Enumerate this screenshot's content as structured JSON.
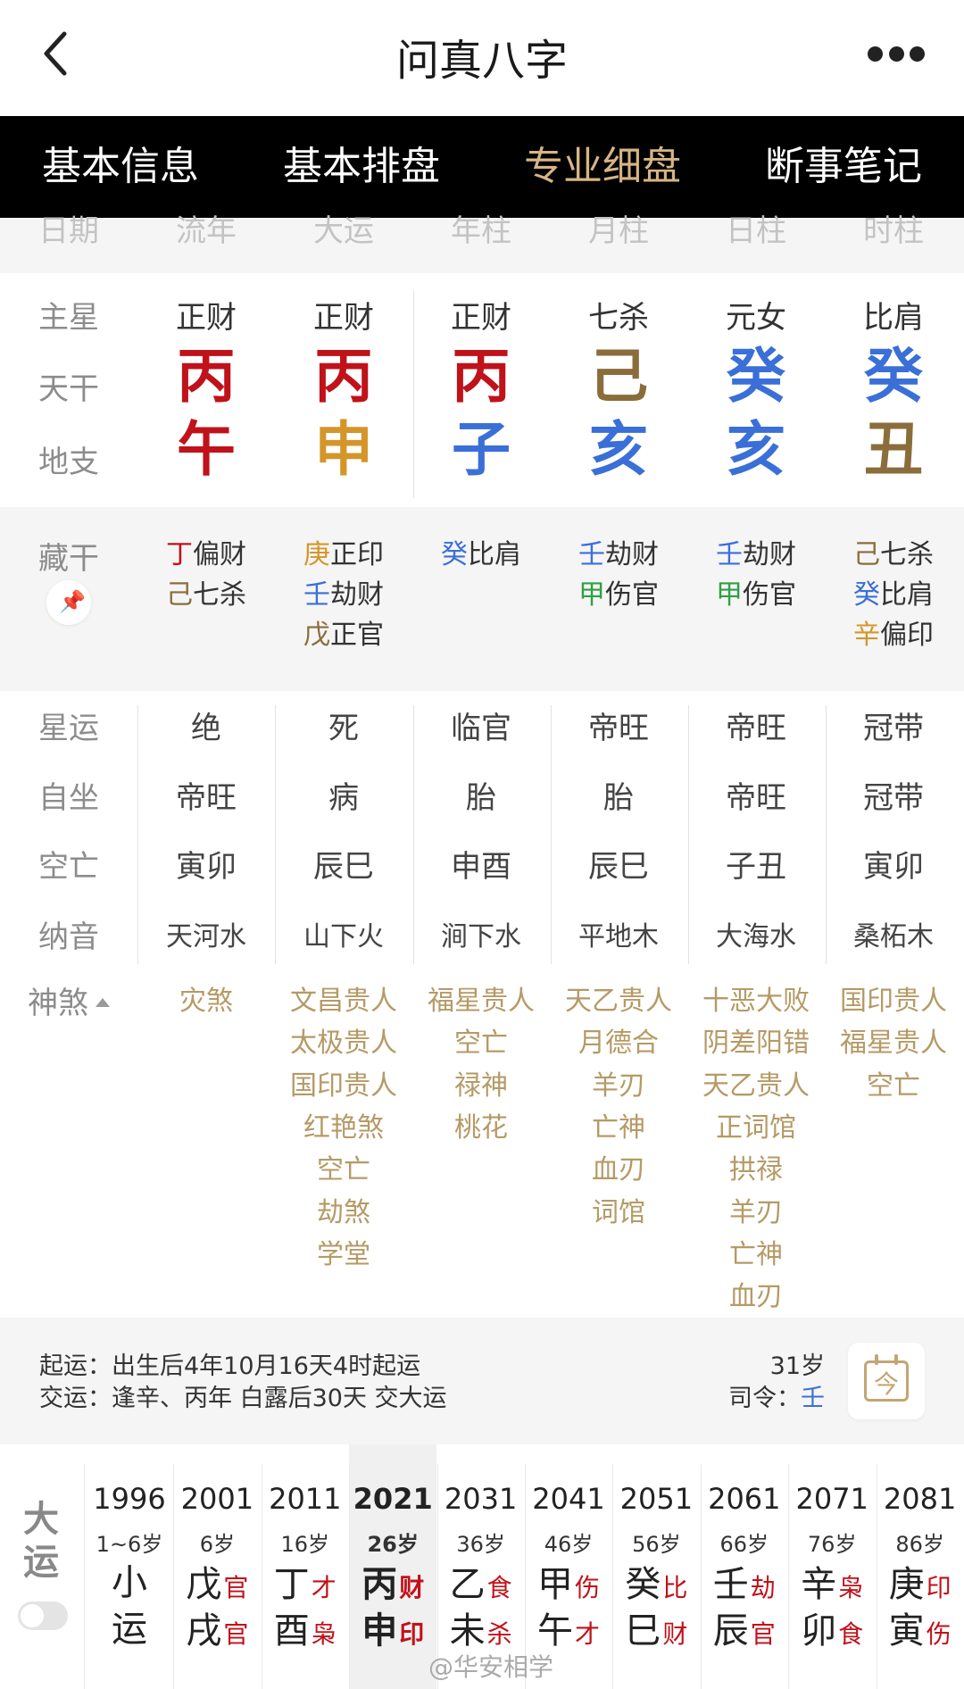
{
  "app": {
    "title": "问真八字"
  },
  "tabs": [
    "基本信息",
    "基本排盘",
    "专业细盘",
    "断事笔记"
  ],
  "column_header": [
    "日期",
    "流年",
    "大运",
    "年柱",
    "月柱",
    "日柱",
    "时柱"
  ],
  "row_labels": {
    "zhuxing": "主星",
    "tiangan": "天干",
    "dizhi": "地支",
    "canggan": "藏干",
    "xingyun": "星运",
    "zizuo": "自坐",
    "kongwang": "空亡",
    "nayin": "纳音",
    "shensha": "神煞"
  },
  "columns": [
    {
      "zhuxing": "正财",
      "tiangan": "丙",
      "tiangan_color": "#c0121a",
      "dizhi": "午",
      "dizhi_color": "#c0121a",
      "canggan": [
        {
          "gan": "丁",
          "color": "#c0121a",
          "shen": "偏财"
        },
        {
          "gan": "己",
          "color": "#8a6d3b",
          "shen": "七杀"
        }
      ],
      "xingyun": "绝",
      "zizuo": "帝旺",
      "kongwang": "寅卯",
      "nayin": "天河水",
      "shensha": [
        "灾煞"
      ]
    },
    {
      "zhuxing": "正财",
      "tiangan": "丙",
      "tiangan_color": "#c0121a",
      "dizhi": "申",
      "dizhi_color": "#d4962a",
      "canggan": [
        {
          "gan": "庚",
          "color": "#d4962a",
          "shen": "正印"
        },
        {
          "gan": "壬",
          "color": "#3a6fd8",
          "shen": "劫财"
        },
        {
          "gan": "戊",
          "color": "#8a6d3b",
          "shen": "正官"
        }
      ],
      "xingyun": "死",
      "zizuo": "病",
      "kongwang": "辰巳",
      "nayin": "山下火",
      "shensha": [
        "文昌贵人",
        "太极贵人",
        "国印贵人",
        "红艳煞",
        "空亡",
        "劫煞",
        "学堂"
      ]
    },
    {
      "zhuxing": "正财",
      "tiangan": "丙",
      "tiangan_color": "#c0121a",
      "dizhi": "子",
      "dizhi_color": "#3a6fd8",
      "canggan": [
        {
          "gan": "癸",
          "color": "#3a6fd8",
          "shen": "比肩"
        }
      ],
      "xingyun": "临官",
      "zizuo": "胎",
      "kongwang": "申酉",
      "nayin": "涧下水",
      "shensha": [
        "福星贵人",
        "空亡",
        "禄神",
        "桃花"
      ]
    },
    {
      "zhuxing": "七杀",
      "tiangan": "己",
      "tiangan_color": "#8a6d3b",
      "dizhi": "亥",
      "dizhi_color": "#3a6fd8",
      "canggan": [
        {
          "gan": "壬",
          "color": "#3a6fd8",
          "shen": "劫财"
        },
        {
          "gan": "甲",
          "color": "#2ea043",
          "shen": "伤官"
        }
      ],
      "xingyun": "帝旺",
      "zizuo": "胎",
      "kongwang": "辰巳",
      "nayin": "平地木",
      "shensha": [
        "天乙贵人",
        "月德合",
        "羊刃",
        "亡神",
        "血刃",
        "词馆"
      ]
    },
    {
      "zhuxing": "元女",
      "tiangan": "癸",
      "tiangan_color": "#3a6fd8",
      "dizhi": "亥",
      "dizhi_color": "#3a6fd8",
      "canggan": [
        {
          "gan": "壬",
          "color": "#3a6fd8",
          "shen": "劫财"
        },
        {
          "gan": "甲",
          "color": "#2ea043",
          "shen": "伤官"
        }
      ],
      "xingyun": "帝旺",
      "zizuo": "帝旺",
      "kongwang": "子丑",
      "nayin": "大海水",
      "shensha": [
        "十恶大败",
        "阴差阳错",
        "天乙贵人",
        "正词馆",
        "拱禄",
        "羊刃",
        "亡神",
        "血刃"
      ]
    },
    {
      "zhuxing": "比肩",
      "tiangan": "癸",
      "tiangan_color": "#3a6fd8",
      "dizhi": "丑",
      "dizhi_color": "#8a6d3b",
      "canggan": [
        {
          "gan": "己",
          "color": "#8a6d3b",
          "shen": "七杀"
        },
        {
          "gan": "癸",
          "color": "#3a6fd8",
          "shen": "比肩"
        },
        {
          "gan": "辛",
          "color": "#d4962a",
          "shen": "偏印"
        }
      ],
      "xingyun": "冠带",
      "zizuo": "冠带",
      "kongwang": "寅卯",
      "nayin": "桑柘木",
      "shensha": [
        "国印贵人",
        "福星贵人",
        "空亡"
      ]
    }
  ],
  "info": {
    "qiyun": "起运：出生后4年10月16天4时起运",
    "jiaoyun": "交运：逢辛、丙年 白露后30天 交大运",
    "age": "31岁",
    "siling_label": "司令：",
    "siling_value": "壬",
    "calendar_glyph": "今"
  },
  "dayun": {
    "label": "大运",
    "selected_index": 3,
    "items": [
      {
        "year": "1996",
        "age": "1~6岁",
        "xiaoyun": [
          "小",
          "运"
        ]
      },
      {
        "year": "2001",
        "age": "6岁",
        "gan": "戊",
        "gan_shen": "官",
        "gan_shen_color": "#c0121a",
        "zhi": "戌",
        "zhi_shen": "官",
        "zhi_shen_color": "#c0121a"
      },
      {
        "year": "2011",
        "age": "16岁",
        "gan": "丁",
        "gan_shen": "才",
        "gan_shen_color": "#c0121a",
        "zhi": "酉",
        "zhi_shen": "枭",
        "zhi_shen_color": "#c0121a"
      },
      {
        "year": "2021",
        "age": "26岁",
        "gan": "丙",
        "gan_shen": "财",
        "gan_shen_color": "#c0121a",
        "zhi": "申",
        "zhi_shen": "印",
        "zhi_shen_color": "#c0121a"
      },
      {
        "year": "2031",
        "age": "36岁",
        "gan": "乙",
        "gan_shen": "食",
        "gan_shen_color": "#c0121a",
        "zhi": "未",
        "zhi_shen": "杀",
        "zhi_shen_color": "#c0121a"
      },
      {
        "year": "2041",
        "age": "46岁",
        "gan": "甲",
        "gan_shen": "伤",
        "gan_shen_color": "#c0121a",
        "zhi": "午",
        "zhi_shen": "才",
        "zhi_shen_color": "#c0121a"
      },
      {
        "year": "2051",
        "age": "56岁",
        "gan": "癸",
        "gan_shen": "比",
        "gan_shen_color": "#c0121a",
        "zhi": "巳",
        "zhi_shen": "财",
        "zhi_shen_color": "#c0121a"
      },
      {
        "year": "2061",
        "age": "66岁",
        "gan": "壬",
        "gan_shen": "劫",
        "gan_shen_color": "#c0121a",
        "zhi": "辰",
        "zhi_shen": "官",
        "zhi_shen_color": "#c0121a"
      },
      {
        "year": "2071",
        "age": "76岁",
        "gan": "辛",
        "gan_shen": "枭",
        "gan_shen_color": "#c0121a",
        "zhi": "卯",
        "zhi_shen": "食",
        "zhi_shen_color": "#c0121a"
      },
      {
        "year": "2081",
        "age": "86岁",
        "gan": "庚",
        "gan_shen": "印",
        "gan_shen_color": "#c0121a",
        "zhi": "寅",
        "zhi_shen": "伤",
        "zhi_shen_color": "#c0121a"
      }
    ]
  },
  "watermark": "@华安相学"
}
